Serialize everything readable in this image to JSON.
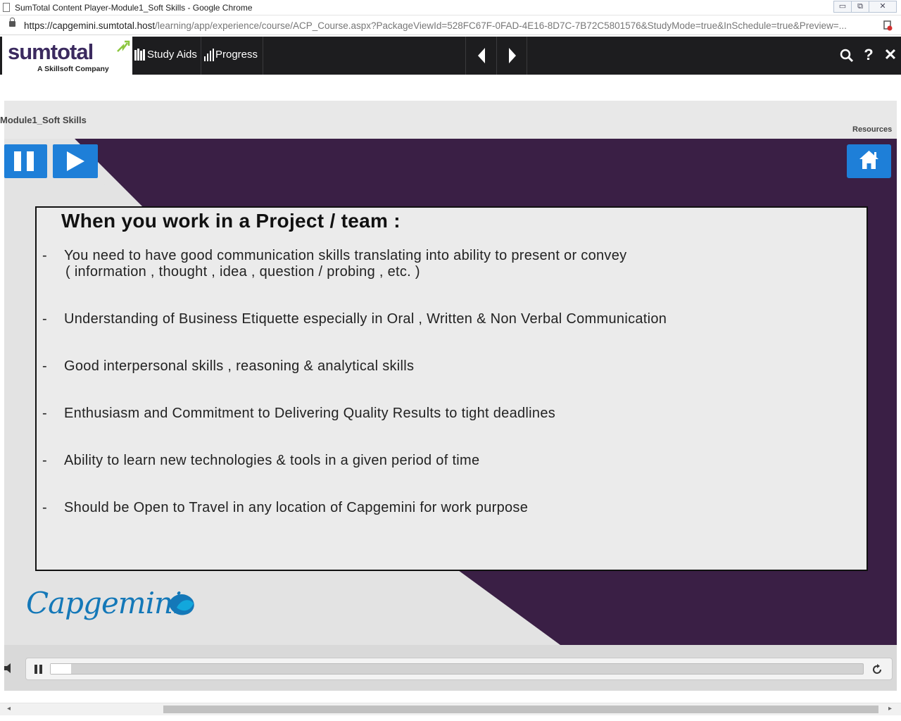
{
  "browser": {
    "window_title": "SumTotal Content Player-Module1_Soft Skills - Google Chrome",
    "url_host": "https://capgemini.sumtotal.host",
    "url_path": "/learning/app/experience/course/ACP_Course.aspx?PackageViewId=528FC67F-0FAD-4E16-8D7C-7B72C5801576&StudyMode=true&InSchedule=true&Preview=..."
  },
  "player": {
    "logo_text": "sumtotal",
    "logo_subtitle": "A Skillsoft Company",
    "nav": {
      "study_aids": "Study Aids",
      "progress": "Progress"
    },
    "tools": {
      "help": "?",
      "close": "✕"
    }
  },
  "course": {
    "module_title": "Module1_Soft Skills",
    "resources_label": "Resources"
  },
  "slide": {
    "title": "When you work in a Project / team :",
    "bullets": [
      {
        "line1": "You need to have good communication skills translating into ability to present or convey",
        "line2": "( information , thought , idea , question / probing , etc. )"
      },
      {
        "line1": "Understanding of Business Etiquette especially in Oral , Written & Non Verbal Communication"
      },
      {
        "line1": "Good interpersonal skills , reasoning & analytical skills"
      },
      {
        "line1": "Enthusiasm and Commitment to Delivering Quality Results to tight deadlines"
      },
      {
        "line1": "Ability to learn new technologies & tools in a given period of time"
      },
      {
        "line1": "Should be Open to Travel in any location of Capgemini for work purpose"
      }
    ],
    "bullet_marker": "-",
    "brand": "Capgemini",
    "colors": {
      "accent_blue": "#1e7fd8",
      "purple": "#3a1f45",
      "capgemini_blue": "#1478b8"
    }
  },
  "playback": {
    "progress_fraction": 0.025
  }
}
